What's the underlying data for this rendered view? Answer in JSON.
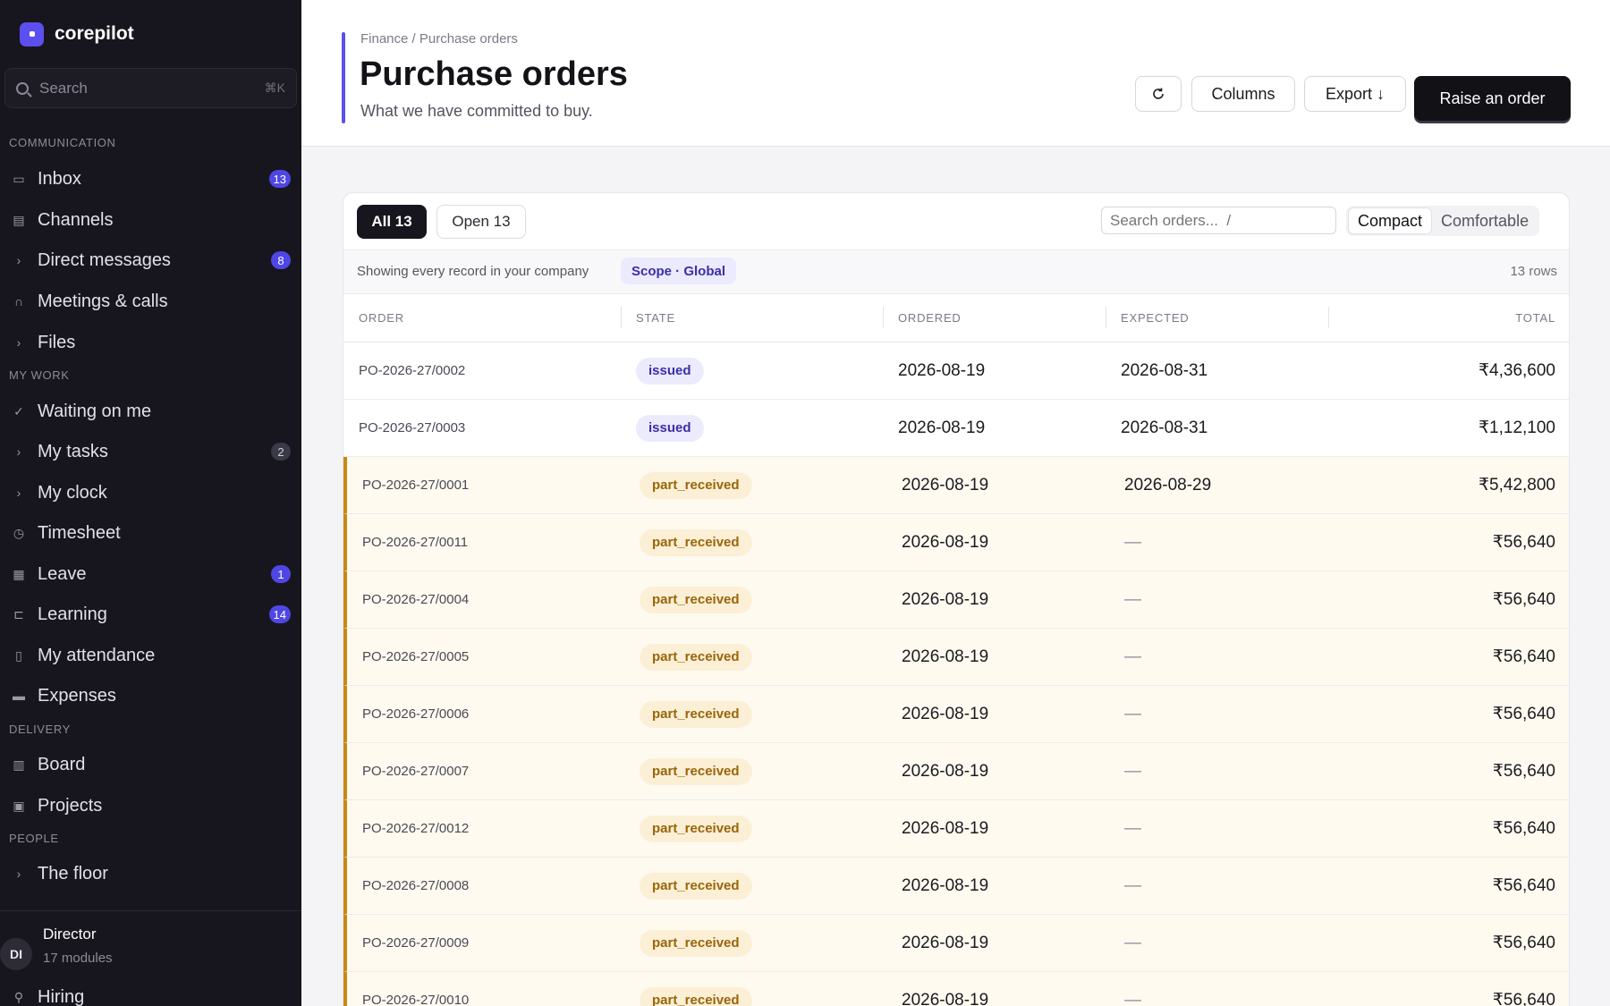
{
  "app": {
    "name": "corepilot"
  },
  "sidebar": {
    "search_placeholder": "Search",
    "search_shortcut": "⌘K",
    "sections": [
      {
        "label": "COMMUNICATION"
      },
      {
        "label": "MY WORK"
      },
      {
        "label": "DELIVERY"
      },
      {
        "label": "PEOPLE"
      }
    ],
    "items": [
      {
        "label": "Inbox",
        "icon": "inbox-icon",
        "badge": "13"
      },
      {
        "label": "Channels",
        "icon": "chat-icon",
        "badge": ""
      },
      {
        "label": "Direct messages",
        "icon": "chevron-right-icon",
        "badge": "8"
      },
      {
        "label": "Meetings & calls",
        "icon": "headset-icon",
        "badge": ""
      },
      {
        "label": "Files",
        "icon": "chevron-right-icon",
        "badge": ""
      },
      {
        "label": "Waiting on me",
        "icon": "check-icon",
        "badge": ""
      },
      {
        "label": "My tasks",
        "icon": "chevron-right-icon",
        "badge": "2"
      },
      {
        "label": "My clock",
        "icon": "chevron-right-icon",
        "badge": ""
      },
      {
        "label": "Timesheet",
        "icon": "clock-icon",
        "badge": ""
      },
      {
        "label": "Leave",
        "icon": "calendar-icon",
        "badge": "1"
      },
      {
        "label": "Learning",
        "icon": "book-icon",
        "badge": "14"
      },
      {
        "label": "My attendance",
        "icon": "phone-icon",
        "badge": ""
      },
      {
        "label": "Expenses",
        "icon": "card-icon",
        "badge": ""
      },
      {
        "label": "Board",
        "icon": "board-icon",
        "badge": ""
      },
      {
        "label": "Projects",
        "icon": "briefcase-icon",
        "badge": ""
      },
      {
        "label": "The floor",
        "icon": "chevron-right-icon",
        "badge": ""
      },
      {
        "label": "Hiring",
        "icon": "user-plus-icon",
        "badge": ""
      }
    ],
    "user": {
      "initials": "DI",
      "name": "Director",
      "subtitle": "17 modules"
    }
  },
  "header": {
    "breadcrumb": "Finance / Purchase orders",
    "title": "Purchase orders",
    "subtitle": "What we have committed to buy.",
    "refresh_icon": "refresh-icon",
    "columns_label": "Columns",
    "export_label": "Export ↓",
    "primary_label": "Raise an order"
  },
  "toolbar": {
    "tabs": [
      {
        "label": "All 13",
        "active": true
      },
      {
        "label": "Open 13",
        "active": false
      }
    ],
    "search_placeholder": "Search orders...  /",
    "density_options": [
      "Compact",
      "Comfortable"
    ],
    "density_selected": "Compact"
  },
  "scope": {
    "text": "Showing every record in your company",
    "pill": "Scope · Global",
    "row_count": "13 rows"
  },
  "table": {
    "columns": [
      "ORDER",
      "STATE",
      "ORDERED",
      "EXPECTED",
      "TOTAL"
    ],
    "rows": [
      {
        "order": "PO-2026-27/0002",
        "state": "issued",
        "ordered": "2026-08-19",
        "expected": "2026-08-31",
        "total": "₹4,36,600"
      },
      {
        "order": "PO-2026-27/0003",
        "state": "issued",
        "ordered": "2026-08-19",
        "expected": "2026-08-31",
        "total": "₹1,12,100"
      },
      {
        "order": "PO-2026-27/0001",
        "state": "part_received",
        "ordered": "2026-08-19",
        "expected": "2026-08-29",
        "total": "₹5,42,800"
      },
      {
        "order": "PO-2026-27/0011",
        "state": "part_received",
        "ordered": "2026-08-19",
        "expected": "—",
        "total": "₹56,640"
      },
      {
        "order": "PO-2026-27/0004",
        "state": "part_received",
        "ordered": "2026-08-19",
        "expected": "—",
        "total": "₹56,640"
      },
      {
        "order": "PO-2026-27/0005",
        "state": "part_received",
        "ordered": "2026-08-19",
        "expected": "—",
        "total": "₹56,640"
      },
      {
        "order": "PO-2026-27/0006",
        "state": "part_received",
        "ordered": "2026-08-19",
        "expected": "—",
        "total": "₹56,640"
      },
      {
        "order": "PO-2026-27/0007",
        "state": "part_received",
        "ordered": "2026-08-19",
        "expected": "—",
        "total": "₹56,640"
      },
      {
        "order": "PO-2026-27/0012",
        "state": "part_received",
        "ordered": "2026-08-19",
        "expected": "—",
        "total": "₹56,640"
      },
      {
        "order": "PO-2026-27/0008",
        "state": "part_received",
        "ordered": "2026-08-19",
        "expected": "—",
        "total": "₹56,640"
      },
      {
        "order": "PO-2026-27/0009",
        "state": "part_received",
        "ordered": "2026-08-19",
        "expected": "—",
        "total": "₹56,640"
      },
      {
        "order": "PO-2026-27/0010",
        "state": "part_received",
        "ordered": "2026-08-19",
        "expected": "—",
        "total": "₹56,640"
      }
    ]
  },
  "colors": {
    "accent": "#5b4ff0",
    "sidebar_bg": "#17161e",
    "issued_pill": "#eceafd",
    "part_received_pill": "#fbefd6",
    "warn_row": "#fffaf0"
  }
}
